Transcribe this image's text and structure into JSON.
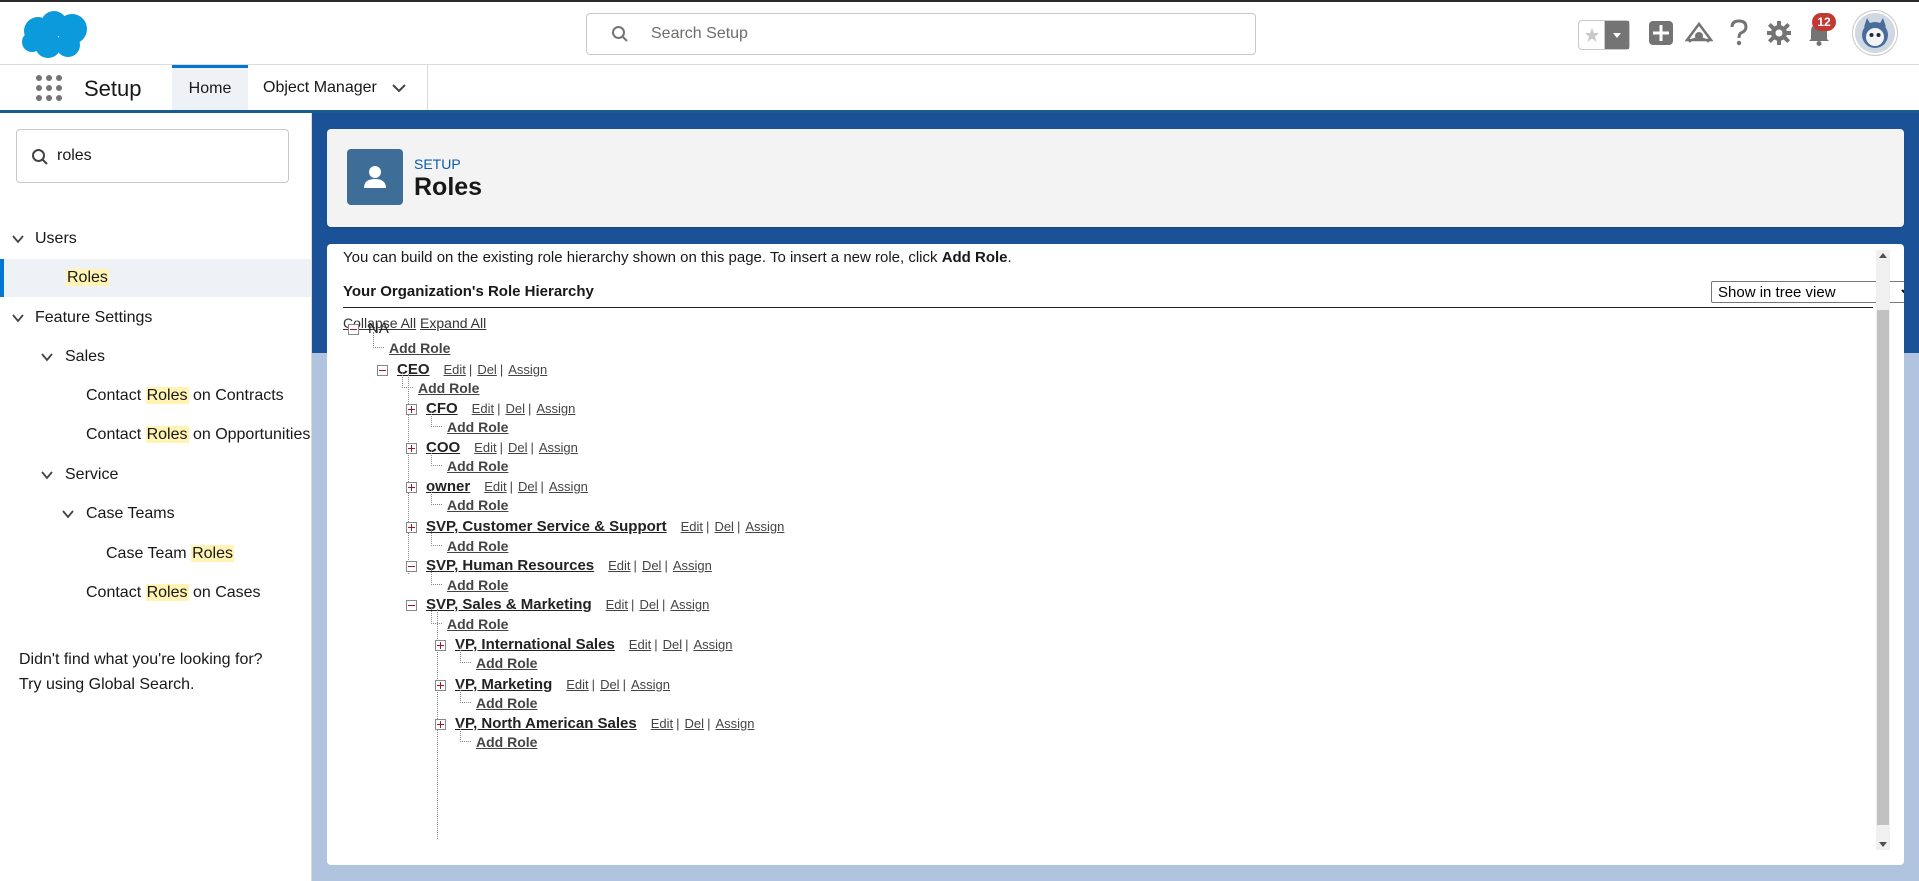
{
  "header": {
    "search_placeholder": "Search Setup",
    "notification_count": "12"
  },
  "context": {
    "app_name": "Setup",
    "tabs": [
      {
        "label": "Home"
      },
      {
        "label": "Object Manager"
      }
    ]
  },
  "sidebar": {
    "quickfind_value": "roles",
    "nodes": [
      {
        "pre": "",
        "hl": "",
        "post": "Users"
      },
      {
        "pre": "",
        "hl": "Roles",
        "post": ""
      },
      {
        "pre": "",
        "hl": "",
        "post": "Feature Settings"
      },
      {
        "pre": "",
        "hl": "",
        "post": "Sales"
      },
      {
        "pre": "Contact ",
        "hl": "Roles",
        "post": " on Contracts"
      },
      {
        "pre": "Contact ",
        "hl": "Roles",
        "post": " on Opportunities"
      },
      {
        "pre": "",
        "hl": "",
        "post": "Service"
      },
      {
        "pre": "",
        "hl": "",
        "post": "Case Teams"
      },
      {
        "pre": "Case Team ",
        "hl": "Roles",
        "post": ""
      },
      {
        "pre": "Contact ",
        "hl": "Roles",
        "post": " on Cases"
      }
    ],
    "not_found_line1": "Didn't find what you're looking for?",
    "not_found_line2": "Try using Global Search."
  },
  "page": {
    "eyebrow": "SETUP",
    "title": "Roles"
  },
  "content": {
    "intro_text": "You can build on the existing role hierarchy shown on this page. To insert a new role, click ",
    "intro_bold": "Add Role",
    "intro_end": ".",
    "hierarchy_heading": "Your Organization's Role Hierarchy",
    "view_option": "Show in tree view",
    "collapse_all": "Collapse All",
    "expand_all": "Expand All",
    "root": "NA",
    "add_role_label": "Add Role",
    "edit_label": "Edit",
    "del_label": "Del",
    "assign_label": "Assign",
    "roles": [
      {
        "name": "CEO",
        "expanded": true
      },
      {
        "name": "CFO",
        "expanded": false
      },
      {
        "name": "COO",
        "expanded": false
      },
      {
        "name": "owner",
        "expanded": false
      },
      {
        "name": "SVP, Customer Service & Support",
        "expanded": false
      },
      {
        "name": "SVP, Human Resources",
        "expanded": true
      },
      {
        "name": "SVP, Sales & Marketing",
        "expanded": true
      },
      {
        "name": "VP, International Sales",
        "expanded": false
      },
      {
        "name": "VP, Marketing",
        "expanded": false
      },
      {
        "name": "VP, North American Sales",
        "expanded": false
      }
    ]
  }
}
